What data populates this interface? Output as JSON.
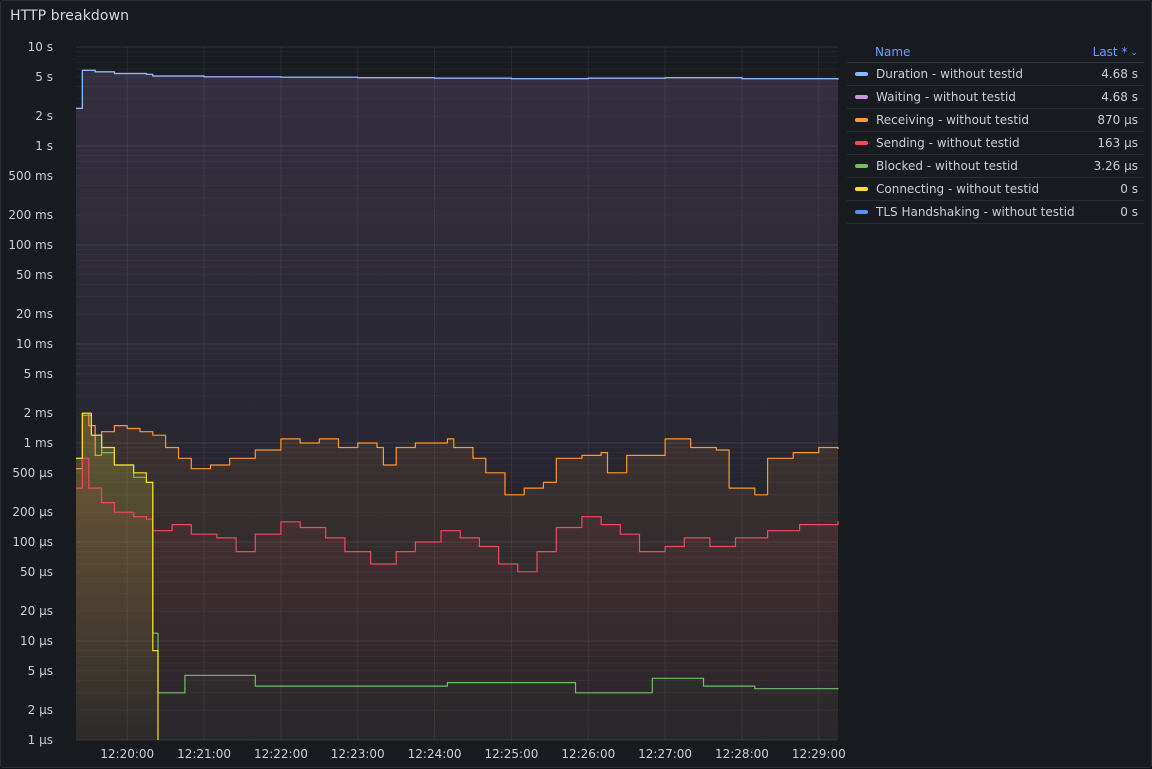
{
  "panel": {
    "title": "HTTP breakdown"
  },
  "legend": {
    "name_header": "Name",
    "value_header": "Last *",
    "items": [
      {
        "name": "Duration - without testid",
        "last": "4.68 s",
        "color": "#8ab8ff"
      },
      {
        "name": "Waiting - without testid",
        "last": "4.68 s",
        "color": "#ca95e5"
      },
      {
        "name": "Receiving - without testid",
        "last": "870 µs",
        "color": "#ff9830"
      },
      {
        "name": "Sending - without testid",
        "last": "163 µs",
        "color": "#f2495c"
      },
      {
        "name": "Blocked - without testid",
        "last": "3.26 µs",
        "color": "#73bf69"
      },
      {
        "name": "Connecting - without testid",
        "last": "0 s",
        "color": "#fade2a"
      },
      {
        "name": "TLS Handshaking - without testid",
        "last": "0 s",
        "color": "#5794f2"
      }
    ]
  },
  "chart_data": {
    "type": "line",
    "scale": "log10",
    "y_unit": "seconds",
    "ylim": [
      1e-06,
      10
    ],
    "grid": true,
    "legend_placement": "right",
    "y_ticks": [
      {
        "value": 10,
        "label": "10 s"
      },
      {
        "value": 5,
        "label": "5 s"
      },
      {
        "value": 2,
        "label": "2 s"
      },
      {
        "value": 1,
        "label": "1 s"
      },
      {
        "value": 0.5,
        "label": "500 ms"
      },
      {
        "value": 0.2,
        "label": "200 ms"
      },
      {
        "value": 0.1,
        "label": "100 ms"
      },
      {
        "value": 0.05,
        "label": "50 ms"
      },
      {
        "value": 0.02,
        "label": "20 ms"
      },
      {
        "value": 0.01,
        "label": "10 ms"
      },
      {
        "value": 0.005,
        "label": "5 ms"
      },
      {
        "value": 0.002,
        "label": "2 ms"
      },
      {
        "value": 0.001,
        "label": "1 ms"
      },
      {
        "value": 0.0005,
        "label": "500 µs"
      },
      {
        "value": 0.0002,
        "label": "200 µs"
      },
      {
        "value": 0.0001,
        "label": "100 µs"
      },
      {
        "value": 5e-05,
        "label": "50 µs"
      },
      {
        "value": 2e-05,
        "label": "20 µs"
      },
      {
        "value": 1e-05,
        "label": "10 µs"
      },
      {
        "value": 5e-06,
        "label": "5 µs"
      },
      {
        "value": 2e-06,
        "label": "2 µs"
      },
      {
        "value": 1e-06,
        "label": "1 µs"
      }
    ],
    "x_ticks": [
      "12:20:00",
      "12:21:00",
      "12:22:00",
      "12:23:00",
      "12:24:00",
      "12:25:00",
      "12:26:00",
      "12:27:00",
      "12:28:00",
      "12:29:00"
    ],
    "x_range": [
      "12:19:20",
      "12:29:15"
    ],
    "series": [
      {
        "name": "Waiting - without testid",
        "color": "#ca95e5",
        "points": [
          [
            "12:19:20",
            2.4
          ],
          [
            "12:19:24",
            2.4
          ],
          [
            "12:19:25",
            5.8
          ],
          [
            "12:19:35",
            5.6
          ],
          [
            "12:19:50",
            5.4
          ],
          [
            "12:20:15",
            5.3
          ],
          [
            "12:20:20",
            5.1
          ],
          [
            "12:21:00",
            5.0
          ],
          [
            "12:22:00",
            4.95
          ],
          [
            "12:23:00",
            4.9
          ],
          [
            "12:24:00",
            4.85
          ],
          [
            "12:25:00",
            4.8
          ],
          [
            "12:26:00",
            4.85
          ],
          [
            "12:27:00",
            4.9
          ],
          [
            "12:28:00",
            4.8
          ],
          [
            "12:29:15",
            4.68
          ]
        ]
      },
      {
        "name": "Duration - without testid",
        "color": "#8ab8ff",
        "points": [
          [
            "12:19:20",
            2.4
          ],
          [
            "12:19:24",
            2.4
          ],
          [
            "12:19:25",
            5.8
          ],
          [
            "12:19:35",
            5.6
          ],
          [
            "12:19:50",
            5.4
          ],
          [
            "12:20:15",
            5.3
          ],
          [
            "12:20:20",
            5.1
          ],
          [
            "12:21:00",
            5.0
          ],
          [
            "12:22:00",
            4.95
          ],
          [
            "12:23:00",
            4.9
          ],
          [
            "12:24:00",
            4.85
          ],
          [
            "12:25:00",
            4.8
          ],
          [
            "12:26:00",
            4.85
          ],
          [
            "12:27:00",
            4.9
          ],
          [
            "12:28:00",
            4.8
          ],
          [
            "12:29:15",
            4.68
          ]
        ]
      },
      {
        "name": "Receiving - without testid",
        "color": "#ff9830",
        "points": [
          [
            "12:19:20",
            0.00055
          ],
          [
            "12:19:25",
            0.002
          ],
          [
            "12:19:30",
            0.0015
          ],
          [
            "12:19:35",
            0.00075
          ],
          [
            "12:19:40",
            0.0013
          ],
          [
            "12:19:50",
            0.0015
          ],
          [
            "12:20:00",
            0.0014
          ],
          [
            "12:20:10",
            0.0013
          ],
          [
            "12:20:20",
            0.0012
          ],
          [
            "12:20:30",
            0.0009
          ],
          [
            "12:20:40",
            0.0007
          ],
          [
            "12:20:50",
            0.00055
          ],
          [
            "12:21:05",
            0.0006
          ],
          [
            "12:21:20",
            0.0007
          ],
          [
            "12:21:40",
            0.00085
          ],
          [
            "12:22:00",
            0.0011
          ],
          [
            "12:22:15",
            0.001
          ],
          [
            "12:22:30",
            0.0011
          ],
          [
            "12:22:45",
            0.0009
          ],
          [
            "12:23:00",
            0.001
          ],
          [
            "12:23:15",
            0.0009
          ],
          [
            "12:23:20",
            0.0006
          ],
          [
            "12:23:30",
            0.0009
          ],
          [
            "12:23:45",
            0.001
          ],
          [
            "12:24:10",
            0.0011
          ],
          [
            "12:24:15",
            0.0009
          ],
          [
            "12:24:30",
            0.0007
          ],
          [
            "12:24:40",
            0.0005
          ],
          [
            "12:24:55",
            0.0003
          ],
          [
            "12:25:10",
            0.00035
          ],
          [
            "12:25:25",
            0.0004
          ],
          [
            "12:25:35",
            0.0007
          ],
          [
            "12:25:55",
            0.00075
          ],
          [
            "12:26:10",
            0.0008
          ],
          [
            "12:26:15",
            0.0005
          ],
          [
            "12:26:30",
            0.00075
          ],
          [
            "12:26:50",
            0.00075
          ],
          [
            "12:27:00",
            0.0011
          ],
          [
            "12:27:20",
            0.0009
          ],
          [
            "12:27:40",
            0.00085
          ],
          [
            "12:27:50",
            0.00035
          ],
          [
            "12:28:10",
            0.0003
          ],
          [
            "12:28:20",
            0.0007
          ],
          [
            "12:28:40",
            0.0008
          ],
          [
            "12:29:00",
            0.0009
          ],
          [
            "12:29:15",
            0.00087
          ]
        ]
      },
      {
        "name": "Sending - without testid",
        "color": "#f2495c",
        "points": [
          [
            "12:19:20",
            0.00035
          ],
          [
            "12:19:25",
            0.0007
          ],
          [
            "12:19:30",
            0.00035
          ],
          [
            "12:19:40",
            0.00025
          ],
          [
            "12:19:50",
            0.0002
          ],
          [
            "12:20:05",
            0.00018
          ],
          [
            "12:20:15",
            0.00017
          ],
          [
            "12:20:20",
            0.00013
          ],
          [
            "12:20:35",
            0.00015
          ],
          [
            "12:20:50",
            0.00012
          ],
          [
            "12:21:10",
            0.00011
          ],
          [
            "12:21:25",
            8e-05
          ],
          [
            "12:21:40",
            0.00012
          ],
          [
            "12:22:00",
            0.00016
          ],
          [
            "12:22:15",
            0.00014
          ],
          [
            "12:22:35",
            0.00011
          ],
          [
            "12:22:50",
            8e-05
          ],
          [
            "12:23:05",
            8e-05
          ],
          [
            "12:23:10",
            6e-05
          ],
          [
            "12:23:30",
            8e-05
          ],
          [
            "12:23:45",
            0.0001
          ],
          [
            "12:24:05",
            0.00013
          ],
          [
            "12:24:20",
            0.00011
          ],
          [
            "12:24:35",
            9e-05
          ],
          [
            "12:24:50",
            6e-05
          ],
          [
            "12:25:05",
            5e-05
          ],
          [
            "12:25:20",
            8e-05
          ],
          [
            "12:25:35",
            0.00014
          ],
          [
            "12:25:55",
            0.00018
          ],
          [
            "12:26:10",
            0.00015
          ],
          [
            "12:26:25",
            0.00012
          ],
          [
            "12:26:40",
            8e-05
          ],
          [
            "12:27:00",
            9e-05
          ],
          [
            "12:27:15",
            0.00011
          ],
          [
            "12:27:35",
            9e-05
          ],
          [
            "12:27:55",
            0.00011
          ],
          [
            "12:28:20",
            0.00013
          ],
          [
            "12:28:45",
            0.00015
          ],
          [
            "12:29:15",
            0.000163
          ]
        ]
      },
      {
        "name": "Blocked - without testid",
        "color": "#73bf69",
        "points": [
          [
            "12:19:20",
            0.0007
          ],
          [
            "12:19:25",
            0.0019
          ],
          [
            "12:19:32",
            0.0012
          ],
          [
            "12:19:40",
            0.0008
          ],
          [
            "12:19:50",
            0.0006
          ],
          [
            "12:20:05",
            0.00045
          ],
          [
            "12:20:15",
            0.0004
          ],
          [
            "12:20:19",
            0.0004
          ],
          [
            "12:20:20",
            1.2e-05
          ],
          [
            "12:20:24",
            3e-06
          ],
          [
            "12:20:45",
            4.5e-06
          ],
          [
            "12:21:10",
            4.5e-06
          ],
          [
            "12:21:40",
            3.5e-06
          ],
          [
            "12:23:00",
            3.5e-06
          ],
          [
            "12:24:10",
            3.8e-06
          ],
          [
            "12:25:00",
            3.8e-06
          ],
          [
            "12:25:50",
            3e-06
          ],
          [
            "12:26:50",
            4.2e-06
          ],
          [
            "12:27:30",
            3.5e-06
          ],
          [
            "12:28:10",
            3.3e-06
          ],
          [
            "12:29:15",
            3.26e-06
          ]
        ]
      },
      {
        "name": "Connecting - without testid",
        "color": "#fade2a",
        "points": [
          [
            "12:19:20",
            0.0007
          ],
          [
            "12:19:25",
            0.002
          ],
          [
            "12:19:32",
            0.0012
          ],
          [
            "12:19:40",
            0.0009
          ],
          [
            "12:19:50",
            0.0006
          ],
          [
            "12:20:05",
            0.0005
          ],
          [
            "12:20:15",
            0.0004
          ],
          [
            "12:20:19",
            0.0004
          ],
          [
            "12:20:20",
            8e-06
          ],
          [
            "12:20:24",
            8e-06
          ],
          [
            "12:20:24",
            1e-06
          ]
        ]
      }
    ]
  }
}
